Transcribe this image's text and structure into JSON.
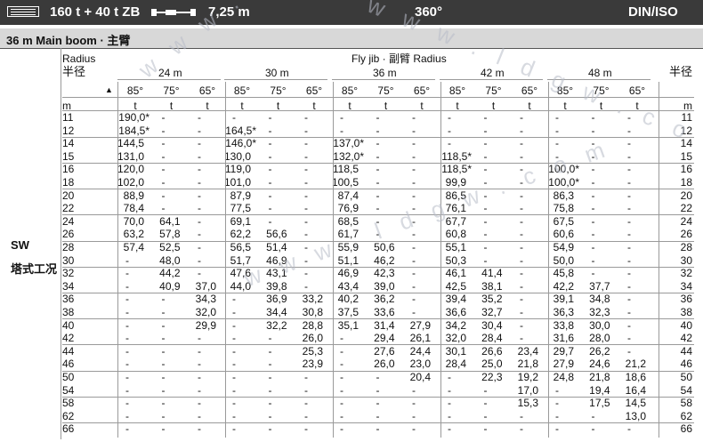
{
  "topbar": {
    "counterweight": "160 t + 40 t ZB",
    "track_width": "7,25 m",
    "slewing": "360°",
    "standard": "DIN/ISO"
  },
  "subbar": {
    "boom": "36 m  Main boom · 主臂"
  },
  "header": {
    "radius_en": "Radius",
    "radius_cn": "半径",
    "radius_cn_right": "半径",
    "fly_jib": "Fly jib · 副臂 Radius",
    "unit_m": "m",
    "unit_t": "t"
  },
  "jib_lengths": [
    "24 m",
    "30 m",
    "36 m",
    "42 m",
    "48 m"
  ],
  "angles": [
    "85°",
    "75°",
    "65°"
  ],
  "side_label": {
    "line1": "SW",
    "line2": "塔式工况"
  },
  "rows": [
    {
      "r": "11",
      "v": [
        "190,0*",
        "-",
        "-",
        "-",
        "-",
        "-",
        "-",
        "-",
        "-",
        "-",
        "-",
        "-",
        "-",
        "-",
        "-"
      ]
    },
    {
      "r": "12",
      "v": [
        "184,5*",
        "-",
        "-",
        "164,5*",
        "-",
        "-",
        "-",
        "-",
        "-",
        "-",
        "-",
        "-",
        "-",
        "-",
        "-"
      ]
    },
    {
      "r": "14",
      "v": [
        "144,5",
        "-",
        "-",
        "146,0*",
        "-",
        "-",
        "137,0*",
        "-",
        "-",
        "-",
        "-",
        "-",
        "-",
        "-",
        "-"
      ]
    },
    {
      "r": "15",
      "v": [
        "131,0",
        "-",
        "-",
        "130,0",
        "-",
        "-",
        "132,0*",
        "-",
        "-",
        "118,5*",
        "-",
        "-",
        "-",
        "-",
        "-"
      ]
    },
    {
      "r": "16",
      "v": [
        "120,0",
        "-",
        "-",
        "119,0",
        "-",
        "-",
        "118,5",
        "-",
        "-",
        "118,5*",
        "-",
        "-",
        "100,0*",
        "-",
        "-"
      ]
    },
    {
      "r": "18",
      "v": [
        "102,0",
        "-",
        "-",
        "101,0",
        "-",
        "-",
        "100,5",
        "-",
        "-",
        "99,9",
        "-",
        "-",
        "100,0*",
        "-",
        "-"
      ]
    },
    {
      "r": "20",
      "v": [
        "88,9",
        "-",
        "-",
        "87,9",
        "-",
        "-",
        "87,4",
        "-",
        "-",
        "86,5",
        "-",
        "-",
        "86,3",
        "-",
        "-"
      ]
    },
    {
      "r": "22",
      "v": [
        "78,4",
        "-",
        "-",
        "77,5",
        "-",
        "-",
        "76,9",
        "-",
        "-",
        "76,1",
        "-",
        "-",
        "75,8",
        "-",
        "-"
      ]
    },
    {
      "r": "24",
      "v": [
        "70,0",
        "64,1",
        "-",
        "69,1",
        "-",
        "-",
        "68,5",
        "-",
        "-",
        "67,7",
        "-",
        "-",
        "67,5",
        "-",
        "-"
      ]
    },
    {
      "r": "26",
      "v": [
        "63,2",
        "57,8",
        "-",
        "62,2",
        "56,6",
        "-",
        "61,7",
        "-",
        "-",
        "60,8",
        "-",
        "-",
        "60,6",
        "-",
        "-"
      ]
    },
    {
      "r": "28",
      "v": [
        "57,4",
        "52,5",
        "-",
        "56,5",
        "51,4",
        "-",
        "55,9",
        "50,6",
        "-",
        "55,1",
        "-",
        "-",
        "54,9",
        "-",
        "-"
      ]
    },
    {
      "r": "30",
      "v": [
        "-",
        "48,0",
        "-",
        "51,7",
        "46,9",
        "-",
        "51,1",
        "46,2",
        "-",
        "50,3",
        "-",
        "-",
        "50,0",
        "-",
        "-"
      ]
    },
    {
      "r": "32",
      "v": [
        "-",
        "44,2",
        "-",
        "47,6",
        "43,1",
        "-",
        "46,9",
        "42,3",
        "-",
        "46,1",
        "41,4",
        "-",
        "45,8",
        "-",
        "-"
      ]
    },
    {
      "r": "34",
      "v": [
        "-",
        "40,9",
        "37,0",
        "44,0",
        "39,8",
        "-",
        "43,4",
        "39,0",
        "-",
        "42,5",
        "38,1",
        "-",
        "42,2",
        "37,7",
        "-"
      ]
    },
    {
      "r": "36",
      "v": [
        "-",
        "-",
        "34,3",
        "-",
        "36,9",
        "33,2",
        "40,2",
        "36,2",
        "-",
        "39,4",
        "35,2",
        "-",
        "39,1",
        "34,8",
        "-"
      ]
    },
    {
      "r": "38",
      "v": [
        "-",
        "-",
        "32,0",
        "-",
        "34,4",
        "30,8",
        "37,5",
        "33,6",
        "-",
        "36,6",
        "32,7",
        "-",
        "36,3",
        "32,3",
        "-"
      ]
    },
    {
      "r": "40",
      "v": [
        "-",
        "-",
        "29,9",
        "-",
        "32,2",
        "28,8",
        "35,1",
        "31,4",
        "27,9",
        "34,2",
        "30,4",
        "-",
        "33,8",
        "30,0",
        "-"
      ]
    },
    {
      "r": "42",
      "v": [
        "-",
        "-",
        "-",
        "-",
        "-",
        "26,0",
        "-",
        "29,4",
        "26,1",
        "32,0",
        "28,4",
        "-",
        "31,6",
        "28,0",
        "-"
      ]
    },
    {
      "r": "44",
      "v": [
        "-",
        "-",
        "-",
        "-",
        "-",
        "25,3",
        "-",
        "27,6",
        "24,4",
        "30,1",
        "26,6",
        "23,4",
        "29,7",
        "26,2",
        "-"
      ]
    },
    {
      "r": "46",
      "v": [
        "-",
        "-",
        "-",
        "-",
        "-",
        "23,9",
        "-",
        "26,0",
        "23,0",
        "28,4",
        "25,0",
        "21,8",
        "27,9",
        "24,6",
        "21,2"
      ]
    },
    {
      "r": "50",
      "v": [
        "-",
        "-",
        "-",
        "-",
        "-",
        "-",
        "-",
        "-",
        "20,4",
        "-",
        "22,3",
        "19,2",
        "24,8",
        "21,8",
        "18,6"
      ]
    },
    {
      "r": "54",
      "v": [
        "-",
        "-",
        "-",
        "-",
        "-",
        "-",
        "-",
        "-",
        "-",
        "-",
        "-",
        "17,0",
        "-",
        "19,4",
        "16,4"
      ]
    },
    {
      "r": "58",
      "v": [
        "-",
        "-",
        "-",
        "-",
        "-",
        "-",
        "-",
        "-",
        "-",
        "-",
        "-",
        "15,3",
        "-",
        "17,5",
        "14,5"
      ]
    },
    {
      "r": "62",
      "v": [
        "-",
        "-",
        "-",
        "-",
        "-",
        "-",
        "-",
        "-",
        "-",
        "-",
        "-",
        "-",
        "-",
        "-",
        "13,0"
      ]
    },
    {
      "r": "66",
      "v": [
        "-",
        "-",
        "-",
        "-",
        "-",
        "-",
        "-",
        "-",
        "-",
        "-",
        "-",
        "-",
        "-",
        "-",
        "-"
      ]
    }
  ],
  "watermark": "w w w . l d g w . c o m"
}
